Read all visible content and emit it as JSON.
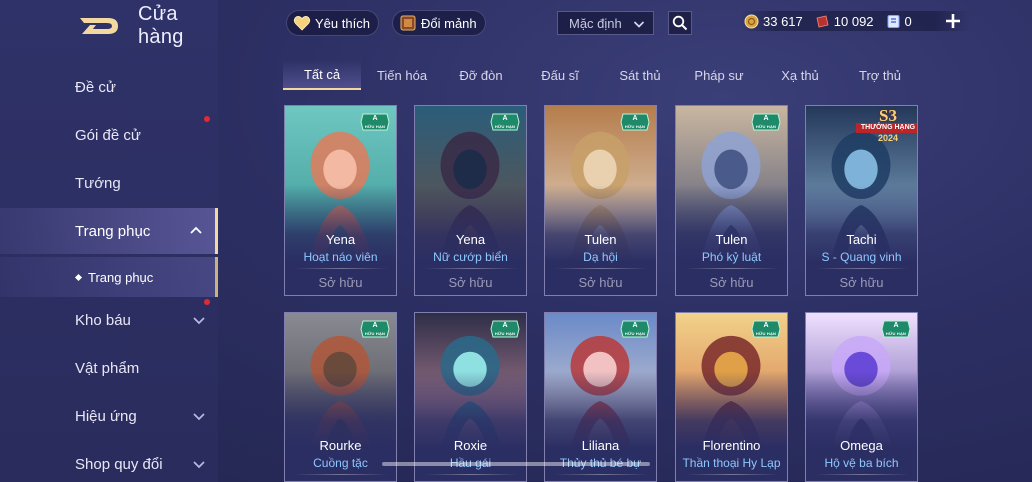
{
  "header": {
    "store_title": "Cửa hàng",
    "favorites_label": "Yêu thích",
    "exchange_label": "Đổi mảnh",
    "sort_selected": "Mặc định"
  },
  "currency": {
    "gold": "33 617",
    "vouchers": "10 092",
    "tickets": "0"
  },
  "sidebar": {
    "items": [
      {
        "label": "Đề cử"
      },
      {
        "label": "Gói đề cử"
      },
      {
        "label": "Tướng"
      },
      {
        "label": "Trang phục"
      },
      {
        "label": "Kho báu"
      },
      {
        "label": "Vật phẩm"
      },
      {
        "label": "Hiệu ứng"
      },
      {
        "label": "Shop quy đổi"
      }
    ],
    "sub_item": "Trang phục"
  },
  "tabs": [
    "Tất cả",
    "Tiến hóa",
    "Đỡ đòn",
    "Đấu sĩ",
    "Sát thủ",
    "Pháp sư",
    "Xạ thủ",
    "Trợ thủ"
  ],
  "cards": [
    {
      "hero": "Yena",
      "skin": "Hoạt náo viên",
      "status": "Sở hữu",
      "rank": "A",
      "rank_tag": "HỮU HẠN"
    },
    {
      "hero": "Yena",
      "skin": "Nữ cướp biển",
      "status": "Sở hữu",
      "rank": "A",
      "rank_tag": "HỮU HẠN"
    },
    {
      "hero": "Tulen",
      "skin": "Dạ hội",
      "status": "Sở hữu",
      "rank": "A",
      "rank_tag": "HỮU HẠN"
    },
    {
      "hero": "Tulen",
      "skin": "Phó kỷ luật",
      "status": "Sở hữu",
      "rank": "A",
      "rank_tag": "HỮU HẠN"
    },
    {
      "hero": "Tachi",
      "skin": "S - Quang vinh",
      "status": "Sở hữu",
      "season": "S3",
      "season_rank": "THƯỞNG HẠNG",
      "season_year": "2024"
    },
    {
      "hero": "Rourke",
      "skin": "Cuồng tặc",
      "rank": "A",
      "rank_tag": "HỮU HẠN"
    },
    {
      "hero": "Roxie",
      "skin": "Hầu gái",
      "rank": "A",
      "rank_tag": "HỮU HẠN"
    },
    {
      "hero": "Liliana",
      "skin": "Thủy thủ bé bự",
      "rank": "A",
      "rank_tag": "HỮU HẠN"
    },
    {
      "hero": "Florentino",
      "skin": "Thần thoại Hy Lạp",
      "rank": "A",
      "rank_tag": "HỮU HẠN"
    },
    {
      "hero": "Omega",
      "skin": "Hộ vệ ba bích",
      "rank": "A",
      "rank_tag": "HỮU HẠN"
    }
  ],
  "colors": {
    "accent_gold": "#f2d9a0",
    "skin_name_blue": "#8ec8ff",
    "badge_green": "#1e8a6a",
    "notification_red": "#e02a34"
  }
}
